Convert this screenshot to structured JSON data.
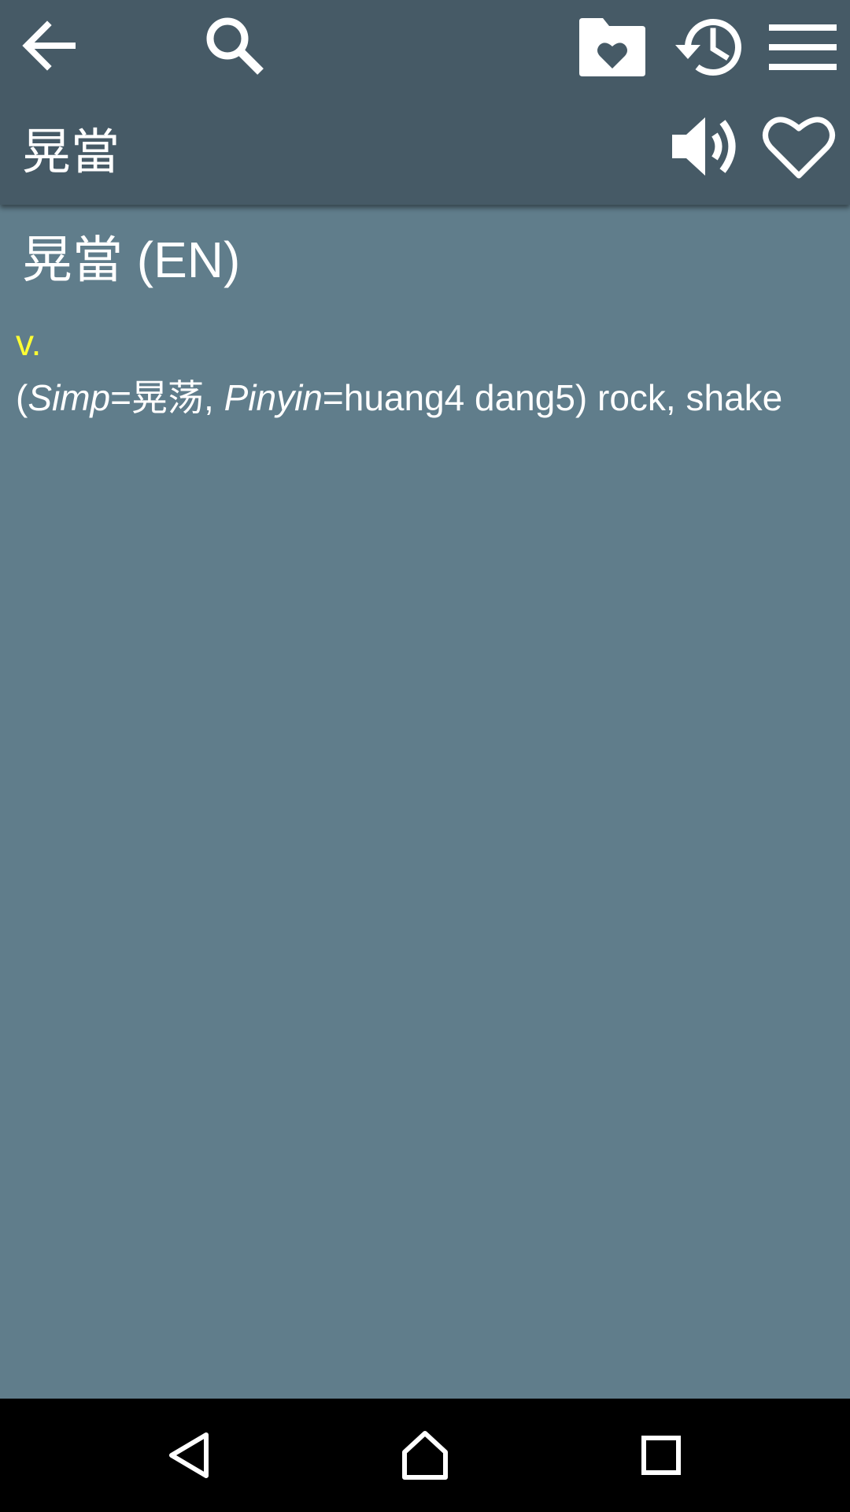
{
  "header": {
    "title": "晃當",
    "icons": {
      "back": "back-arrow-icon",
      "search": "search-icon",
      "favorites_folder": "favorites-folder-icon",
      "history": "history-icon",
      "menu": "menu-icon",
      "speaker": "speaker-icon",
      "favorite": "heart-outline-icon"
    }
  },
  "entry": {
    "heading": "晃當 (EN)",
    "part_of_speech": "v.",
    "open_paren": "(",
    "simp_label": "Simp",
    "simp_value": "=晃荡, ",
    "pinyin_label": "Pinyin",
    "pinyin_value": "=huang4 dang5) rock, shake"
  },
  "colors": {
    "toolbar": "#465a66",
    "content_bg": "#607d8b",
    "pos_color": "#ffff33",
    "text": "#ffffff",
    "navbar": "#000000"
  },
  "navbar": {
    "icons": [
      "nav-back-icon",
      "nav-home-icon",
      "nav-recents-icon"
    ]
  }
}
